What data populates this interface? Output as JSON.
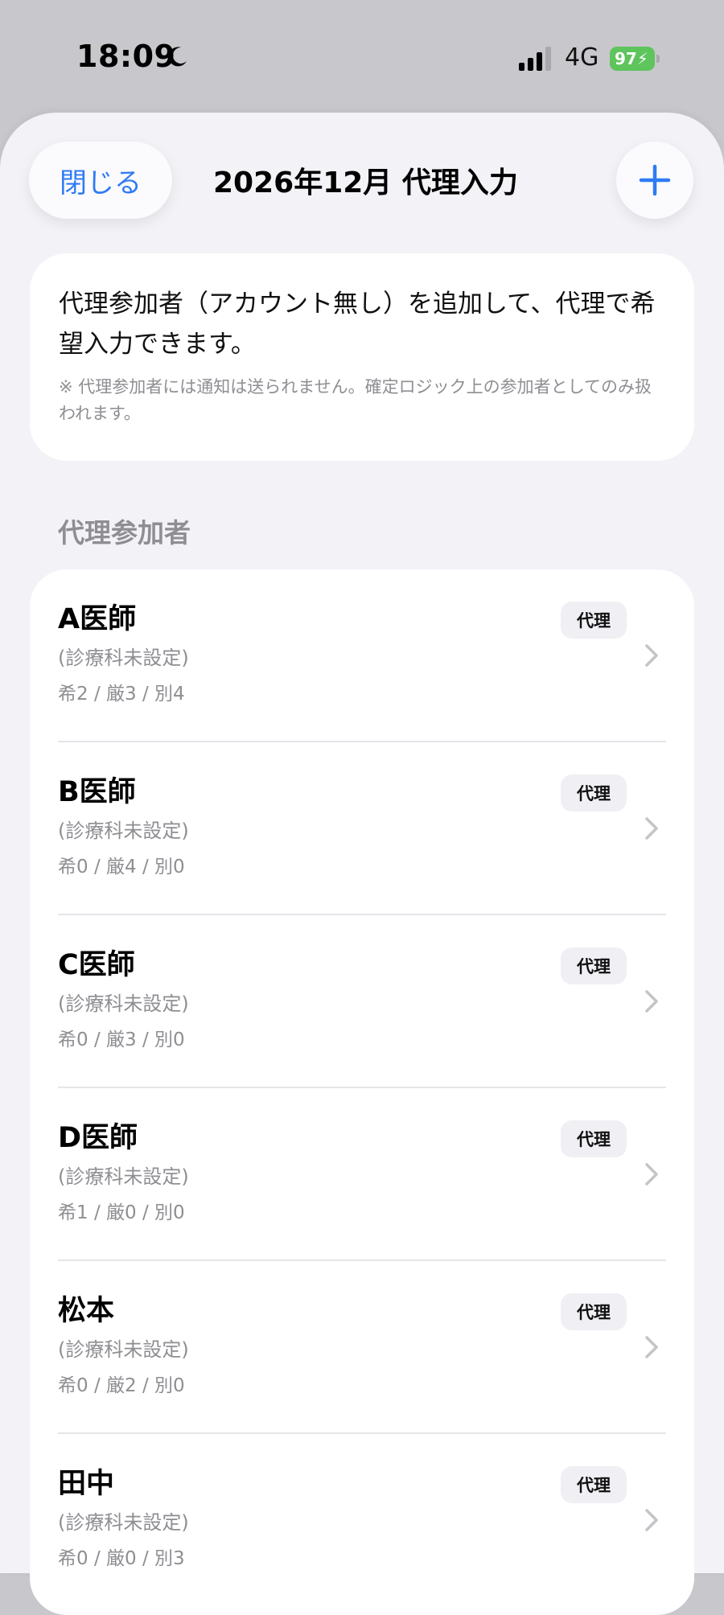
{
  "status_bar": {
    "time": "18:09",
    "network": "4G",
    "battery": "97"
  },
  "header": {
    "close_label": "閉じる",
    "title": "2026年12月 代理入力"
  },
  "info": {
    "text": "代理参加者（アカウント無し）を追加して、代理で希望入力できます。",
    "note": "※ 代理参加者には通知は送られません。確定ロジック上の参加者としてのみ扱われます。"
  },
  "section_title": "代理参加者",
  "participants": [
    {
      "name": "A医師",
      "department": "(診療科未設定)",
      "counts": "希2 / 厳3 / 別4",
      "badge": "代理"
    },
    {
      "name": "B医師",
      "department": "(診療科未設定)",
      "counts": "希0 / 厳4 / 別0",
      "badge": "代理"
    },
    {
      "name": "C医師",
      "department": "(診療科未設定)",
      "counts": "希0 / 厳3 / 別0",
      "badge": "代理"
    },
    {
      "name": "D医師",
      "department": "(診療科未設定)",
      "counts": "希1 / 厳0 / 別0",
      "badge": "代理"
    },
    {
      "name": "松本",
      "department": "(診療科未設定)",
      "counts": "希0 / 厳2 / 別0",
      "badge": "代理"
    },
    {
      "name": "田中",
      "department": "(診療科未設定)",
      "counts": "希0 / 厳0 / 別3",
      "badge": "代理"
    }
  ],
  "colors": {
    "accent": "#2f7bf5",
    "battery": "#5ec45c",
    "secondary_text": "#8e8e93"
  }
}
